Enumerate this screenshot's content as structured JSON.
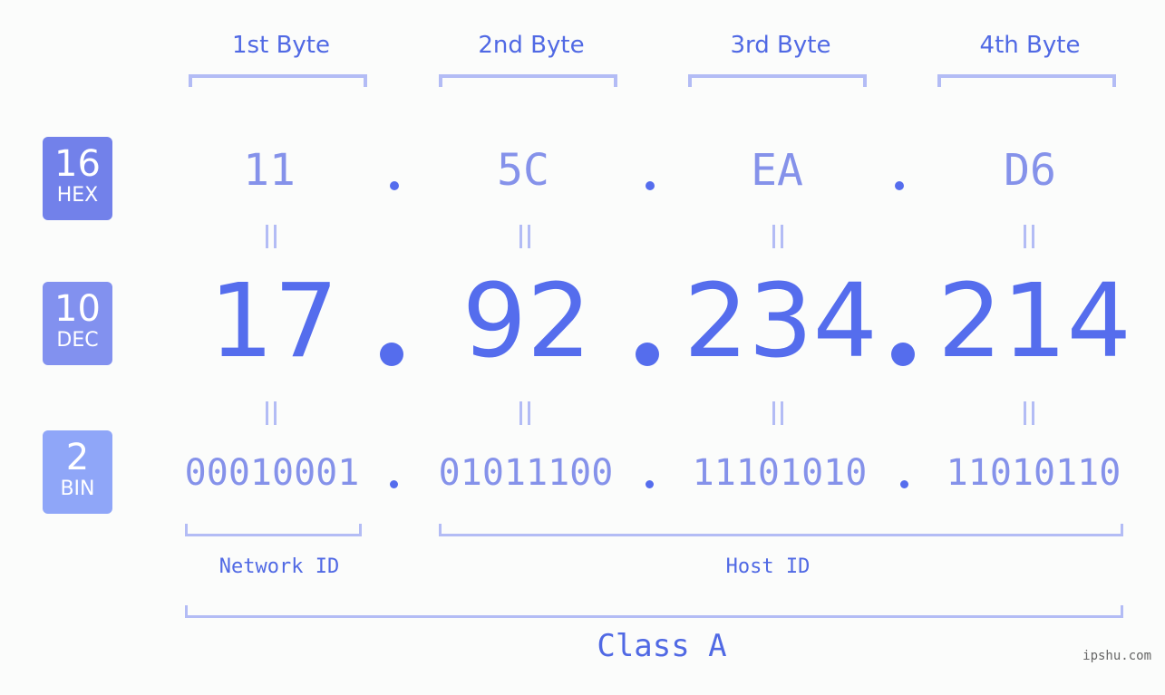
{
  "badges": [
    {
      "base": "16",
      "label": "HEX",
      "color": "#7281ea"
    },
    {
      "base": "10",
      "label": "DEC",
      "color": "#8291ef"
    },
    {
      "base": "2",
      "label": "BIN",
      "color": "#8fa6f8"
    }
  ],
  "bytes": [
    {
      "header": "1st Byte",
      "hex": "11",
      "dec": "17",
      "bin": "00010001"
    },
    {
      "header": "2nd Byte",
      "hex": "5C",
      "dec": "92",
      "bin": "01011100"
    },
    {
      "header": "3rd Byte",
      "hex": "EA",
      "dec": "234",
      "bin": "11101010"
    },
    {
      "header": "4th Byte",
      "hex": "D6",
      "dec": "214",
      "bin": "11010110"
    }
  ],
  "segments": {
    "network_id": "Network ID",
    "host_id": "Host ID"
  },
  "ip_class": "Class A",
  "brand": "ipshu.com",
  "colors": {
    "accent": "#556ded",
    "light_accent": "#8592ea",
    "bracket": "#b3bcf5",
    "background": "#fbfcfb"
  }
}
